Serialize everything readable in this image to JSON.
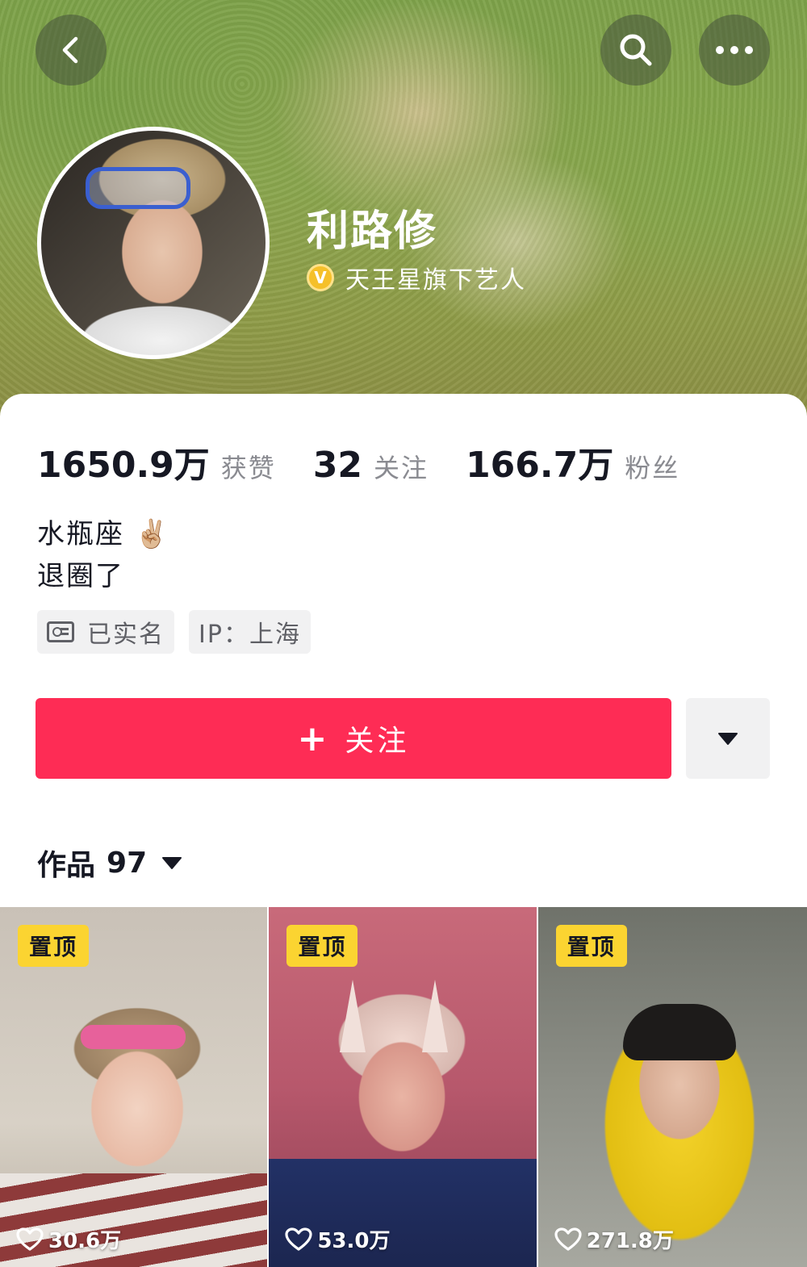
{
  "profile": {
    "name": "利路修",
    "certification": "天王星旗下艺人",
    "cert_badge_letter": "V"
  },
  "stats": {
    "likes_value": "1650.9万",
    "likes_label": "获赞",
    "following_value": "32",
    "following_label": "关注",
    "followers_value": "166.7万",
    "followers_label": "粉丝"
  },
  "bio": {
    "line1": "水瓶座 ✌🏼",
    "line2": "退圈了"
  },
  "tags": {
    "verified": "已实名",
    "ip": "IP：上海"
  },
  "actions": {
    "follow_plus": "+",
    "follow_label": "关注"
  },
  "works": {
    "label": "作品",
    "count": "97"
  },
  "videos": [
    {
      "pin_label": "置顶",
      "likes": "30.6万"
    },
    {
      "pin_label": "置顶",
      "likes": "53.0万"
    },
    {
      "pin_label": "置顶",
      "likes": "271.8万"
    }
  ],
  "icons": {
    "back": "back-arrow-icon",
    "search": "search-icon",
    "more": "more-dots-icon",
    "dropdown": "caret-down-icon",
    "heart": "heart-icon",
    "id_card": "id-card-icon"
  },
  "colors": {
    "accent": "#fe2c55",
    "pin": "#fbd431",
    "cert": "#f5c02a"
  }
}
